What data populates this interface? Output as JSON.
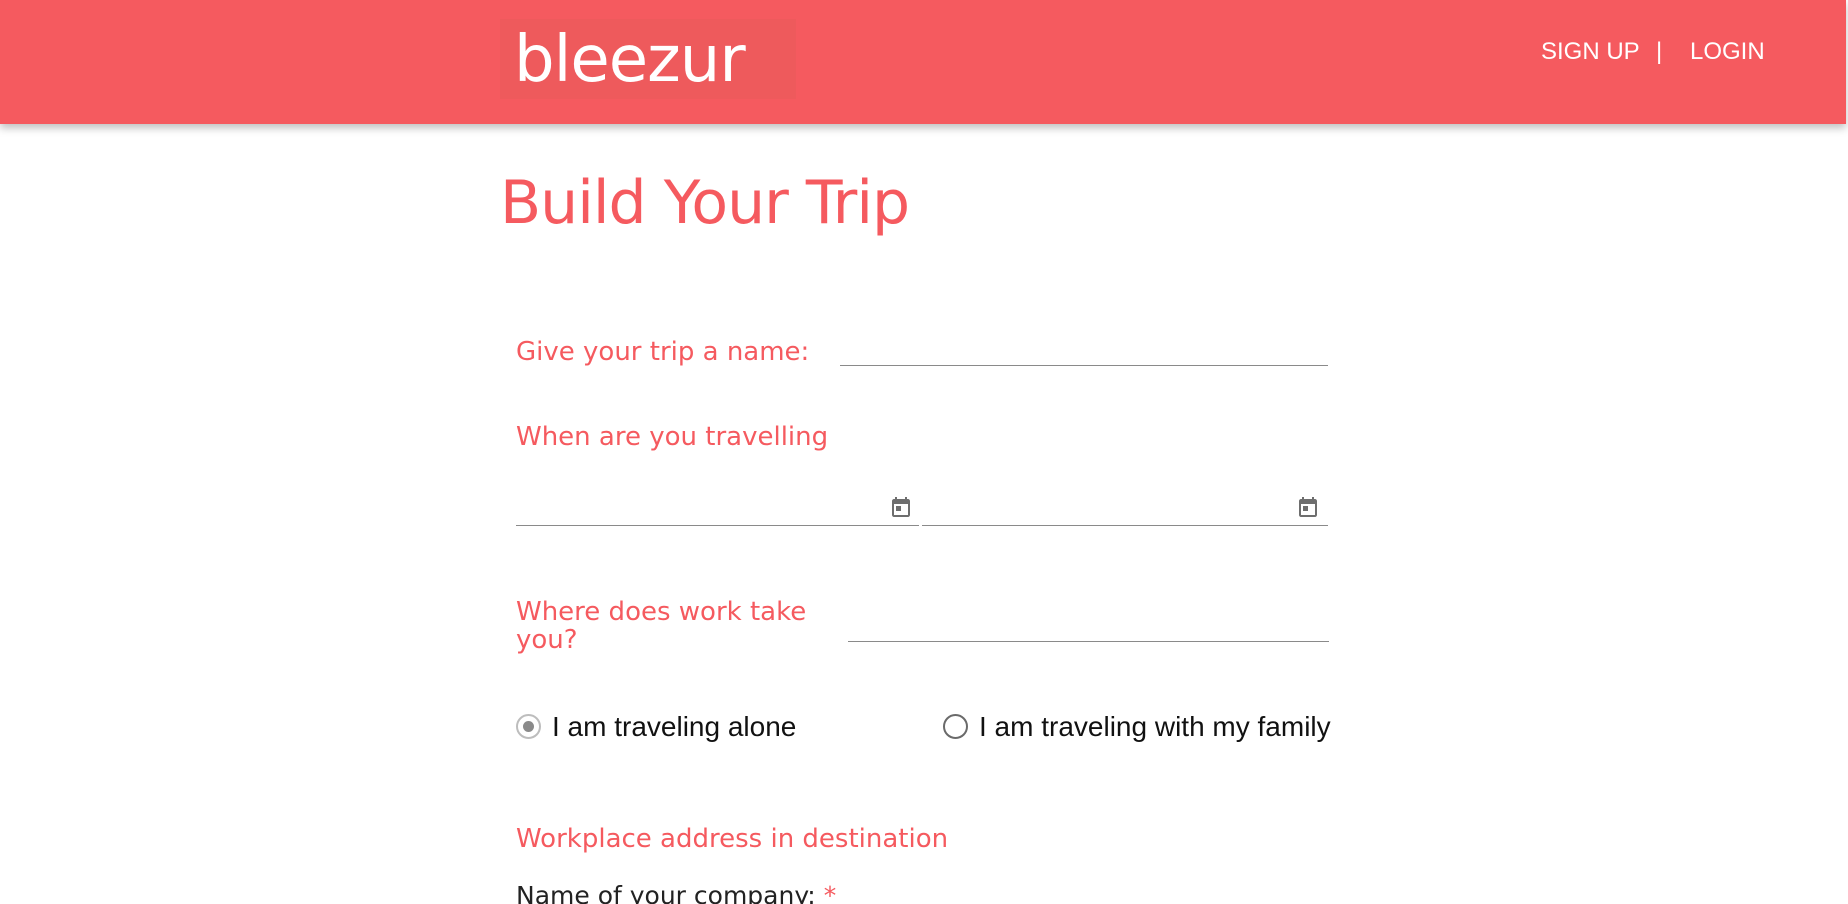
{
  "header": {
    "logo_text": "bleezur",
    "nav": {
      "signup_label": "SIGN UP",
      "separator": "|",
      "login_label": "LOGIN"
    },
    "brand_color": "#f55a5f"
  },
  "main": {
    "title": "Build Your Trip",
    "trip_name": {
      "label": "Give your trip a name:",
      "value": ""
    },
    "travel_dates": {
      "label": "When are you travelling",
      "start_value": "",
      "end_value": "",
      "icon": "calendar-icon"
    },
    "destination": {
      "label": "Where does work take you?",
      "value": ""
    },
    "traveling_options": [
      {
        "label": "I am traveling alone",
        "selected": true
      },
      {
        "label": "I am traveling with my family",
        "selected": false
      }
    ],
    "workplace_section": {
      "heading": "Workplace address in destination",
      "company_label": "Name of your company:",
      "required_marker": "*"
    }
  }
}
